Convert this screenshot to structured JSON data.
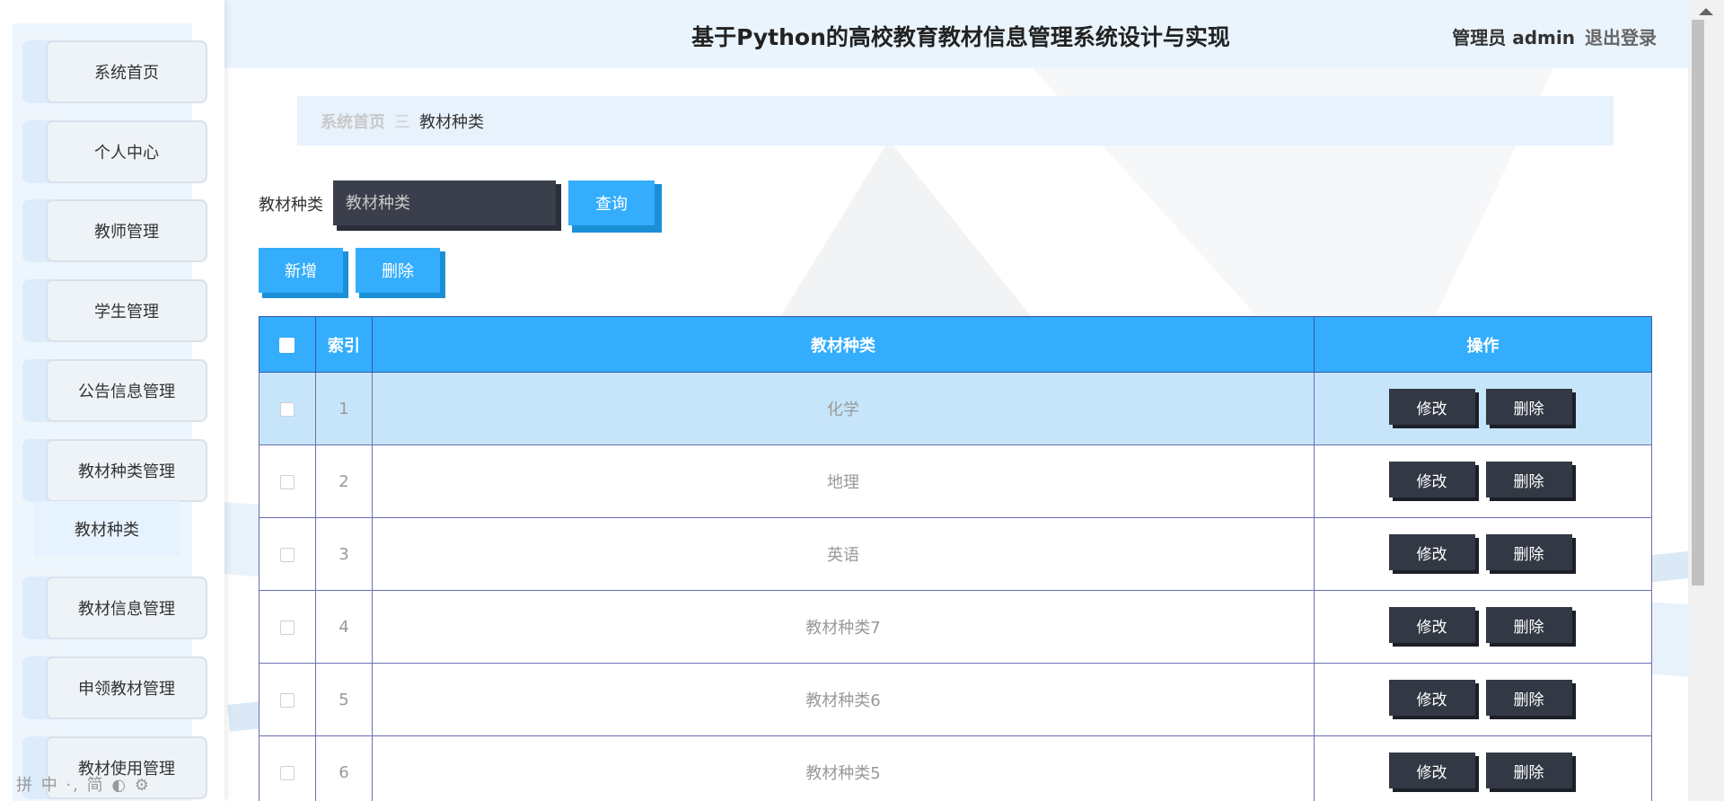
{
  "header": {
    "title": "基于Python的高校教育教材信息管理系统设计与实现",
    "user": "管理员 admin",
    "logout": "退出登录"
  },
  "sidebar": {
    "items": [
      {
        "label": "系统首页"
      },
      {
        "label": "个人中心"
      },
      {
        "label": "教师管理"
      },
      {
        "label": "学生管理"
      },
      {
        "label": "公告信息管理"
      },
      {
        "label": "教材种类管理"
      },
      {
        "label": "教材信息管理"
      },
      {
        "label": "申领教材管理"
      },
      {
        "label": "教材使用管理"
      }
    ],
    "submenu": {
      "label": "教材种类"
    },
    "footer": "拼 中 ·, 简 ◐ ⚙"
  },
  "breadcrumb": {
    "home": "系统首页",
    "separator": "三",
    "current": "教材种类"
  },
  "search": {
    "label": "教材种类",
    "placeholder": "教材种类",
    "button": "查询"
  },
  "actions": {
    "add": "新增",
    "delete": "删除"
  },
  "table": {
    "headers": {
      "index": "索引",
      "name": "教材种类",
      "ops": "操作"
    },
    "rows": [
      {
        "index": "1",
        "name": "化学"
      },
      {
        "index": "2",
        "name": "地理"
      },
      {
        "index": "3",
        "name": "英语"
      },
      {
        "index": "4",
        "name": "教材种类7"
      },
      {
        "index": "5",
        "name": "教材种类6"
      },
      {
        "index": "6",
        "name": "教材种类5"
      }
    ],
    "edit_label": "修改",
    "delete_label": "删除"
  },
  "colors": {
    "accent": "#33adfc",
    "dark_button": "#333845",
    "header_bg": "#eaf4fd",
    "row_highlight": "#c6e5fb"
  }
}
